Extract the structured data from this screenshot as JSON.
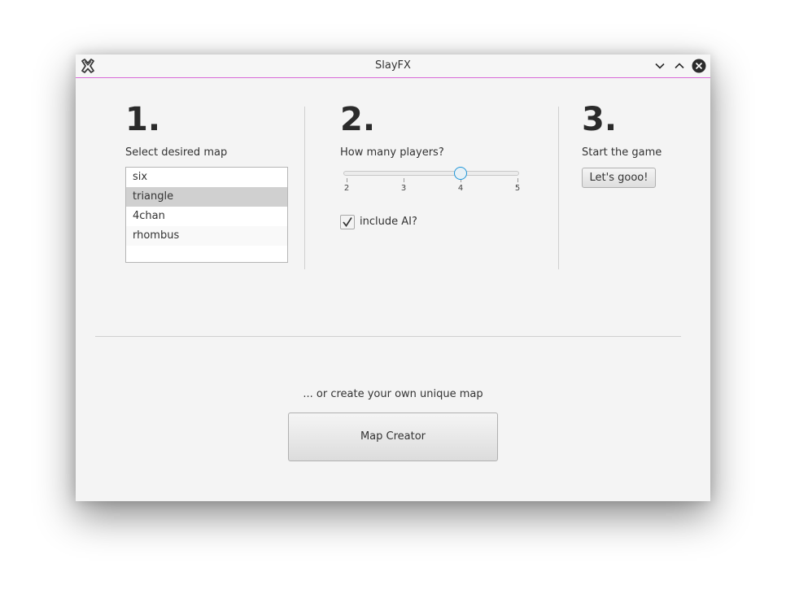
{
  "window": {
    "title": "SlayFX",
    "buttons": {
      "minimize_icon": "chevron-down-icon",
      "maximize_icon": "chevron-up-icon",
      "close_icon": "close-circle-icon"
    },
    "accent_line_color": "#d86ad8"
  },
  "step1": {
    "number": "1.",
    "label": "Select desired map",
    "maps": [
      "six",
      "triangle",
      "4chan",
      "rhombus"
    ],
    "selected": "triangle"
  },
  "step2": {
    "number": "2.",
    "label": "How many players?",
    "slider": {
      "min": 2,
      "max": 5,
      "value": 4,
      "ticks": [
        "2",
        "3",
        "4",
        "5"
      ]
    },
    "include_ai": {
      "label": "include AI?",
      "checked": true
    }
  },
  "step3": {
    "number": "3.",
    "label": "Start the game",
    "button": "Let's gooo!"
  },
  "creator": {
    "label": "... or create your own unique map",
    "button": "Map Creator"
  },
  "colors": {
    "slider_thumb": "#1f96d8",
    "selection": "#d0d0d0"
  }
}
